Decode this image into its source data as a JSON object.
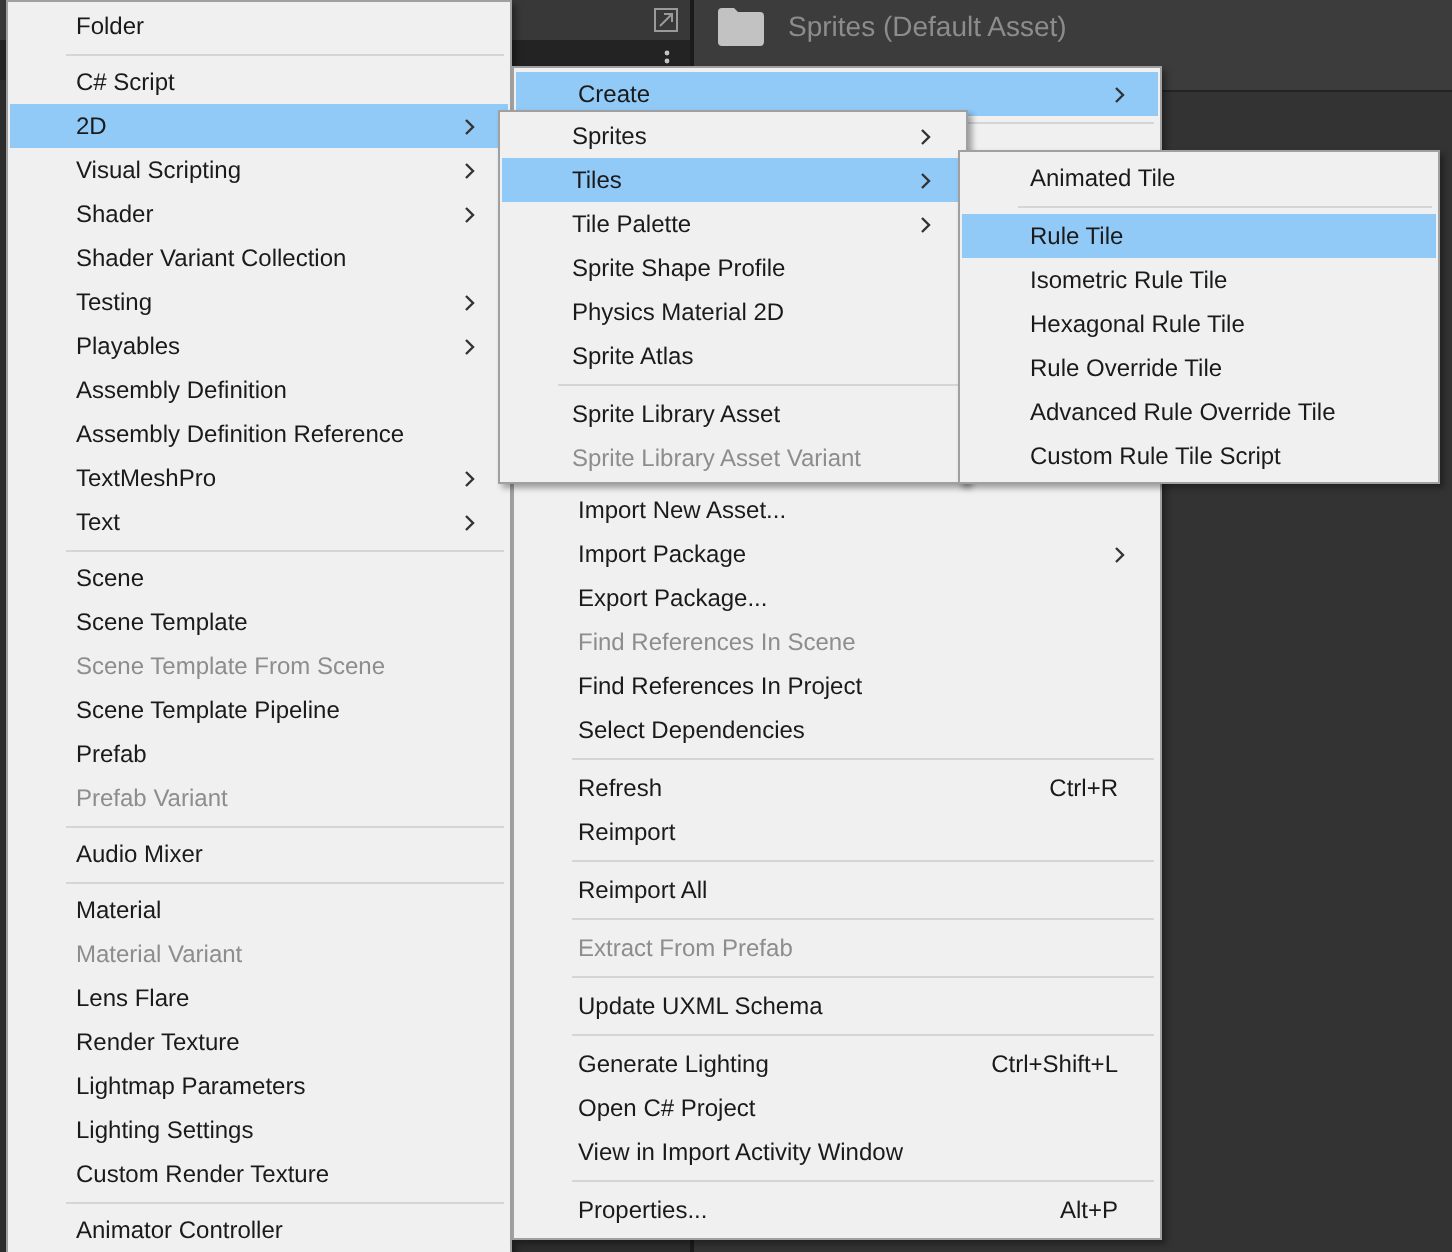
{
  "asset_header": {
    "title": "Sprites (Default Asset)"
  },
  "menus": [
    {
      "items": [
        {
          "kind": "item",
          "label": "Folder",
          "selected": false,
          "disabled": false,
          "submenu": false
        },
        {
          "kind": "separator"
        },
        {
          "kind": "item",
          "label": "C# Script",
          "selected": false,
          "disabled": false,
          "submenu": false
        },
        {
          "kind": "item",
          "label": "2D",
          "selected": true,
          "disabled": false,
          "submenu": true
        },
        {
          "kind": "item",
          "label": "Visual Scripting",
          "selected": false,
          "disabled": false,
          "submenu": true
        },
        {
          "kind": "item",
          "label": "Shader",
          "selected": false,
          "disabled": false,
          "submenu": true
        },
        {
          "kind": "item",
          "label": "Shader Variant Collection",
          "selected": false,
          "disabled": false,
          "submenu": false
        },
        {
          "kind": "item",
          "label": "Testing",
          "selected": false,
          "disabled": false,
          "submenu": true
        },
        {
          "kind": "item",
          "label": "Playables",
          "selected": false,
          "disabled": false,
          "submenu": true
        },
        {
          "kind": "item",
          "label": "Assembly Definition",
          "selected": false,
          "disabled": false,
          "submenu": false
        },
        {
          "kind": "item",
          "label": "Assembly Definition Reference",
          "selected": false,
          "disabled": false,
          "submenu": false
        },
        {
          "kind": "item",
          "label": "TextMeshPro",
          "selected": false,
          "disabled": false,
          "submenu": true
        },
        {
          "kind": "item",
          "label": "Text",
          "selected": false,
          "disabled": false,
          "submenu": true
        },
        {
          "kind": "separator"
        },
        {
          "kind": "item",
          "label": "Scene",
          "selected": false,
          "disabled": false,
          "submenu": false
        },
        {
          "kind": "item",
          "label": "Scene Template",
          "selected": false,
          "disabled": false,
          "submenu": false
        },
        {
          "kind": "item",
          "label": "Scene Template From Scene",
          "selected": false,
          "disabled": true,
          "submenu": false
        },
        {
          "kind": "item",
          "label": "Scene Template Pipeline",
          "selected": false,
          "disabled": false,
          "submenu": false
        },
        {
          "kind": "item",
          "label": "Prefab",
          "selected": false,
          "disabled": false,
          "submenu": false
        },
        {
          "kind": "item",
          "label": "Prefab Variant",
          "selected": false,
          "disabled": true,
          "submenu": false
        },
        {
          "kind": "separator"
        },
        {
          "kind": "item",
          "label": "Audio Mixer",
          "selected": false,
          "disabled": false,
          "submenu": false
        },
        {
          "kind": "separator"
        },
        {
          "kind": "item",
          "label": "Material",
          "selected": false,
          "disabled": false,
          "submenu": false
        },
        {
          "kind": "item",
          "label": "Material Variant",
          "selected": false,
          "disabled": true,
          "submenu": false
        },
        {
          "kind": "item",
          "label": "Lens Flare",
          "selected": false,
          "disabled": false,
          "submenu": false
        },
        {
          "kind": "item",
          "label": "Render Texture",
          "selected": false,
          "disabled": false,
          "submenu": false
        },
        {
          "kind": "item",
          "label": "Lightmap Parameters",
          "selected": false,
          "disabled": false,
          "submenu": false
        },
        {
          "kind": "item",
          "label": "Lighting Settings",
          "selected": false,
          "disabled": false,
          "submenu": false
        },
        {
          "kind": "item",
          "label": "Custom Render Texture",
          "selected": false,
          "disabled": false,
          "submenu": false
        },
        {
          "kind": "separator"
        },
        {
          "kind": "item",
          "label": "Animator Controller",
          "selected": false,
          "disabled": false,
          "submenu": false
        }
      ]
    },
    {
      "items": [
        {
          "kind": "item",
          "label": "Create",
          "selected": true,
          "disabled": false,
          "submenu": true
        },
        {
          "kind": "separator"
        },
        {
          "kind": "hidden"
        },
        {
          "kind": "item",
          "label": "Import New Asset...",
          "selected": false,
          "disabled": false,
          "submenu": false
        },
        {
          "kind": "item",
          "label": "Import Package",
          "selected": false,
          "disabled": false,
          "submenu": true
        },
        {
          "kind": "item",
          "label": "Export Package...",
          "selected": false,
          "disabled": false,
          "submenu": false
        },
        {
          "kind": "item",
          "label": "Find References In Scene",
          "selected": false,
          "disabled": true,
          "submenu": false
        },
        {
          "kind": "item",
          "label": "Find References In Project",
          "selected": false,
          "disabled": false,
          "submenu": false
        },
        {
          "kind": "item",
          "label": "Select Dependencies",
          "selected": false,
          "disabled": false,
          "submenu": false
        },
        {
          "kind": "separator"
        },
        {
          "kind": "item",
          "label": "Refresh",
          "shortcut": "Ctrl+R",
          "selected": false,
          "disabled": false,
          "submenu": false
        },
        {
          "kind": "item",
          "label": "Reimport",
          "selected": false,
          "disabled": false,
          "submenu": false
        },
        {
          "kind": "separator"
        },
        {
          "kind": "item",
          "label": "Reimport All",
          "selected": false,
          "disabled": false,
          "submenu": false
        },
        {
          "kind": "separator"
        },
        {
          "kind": "item",
          "label": "Extract From Prefab",
          "selected": false,
          "disabled": true,
          "submenu": false
        },
        {
          "kind": "separator"
        },
        {
          "kind": "item",
          "label": "Update UXML Schema",
          "selected": false,
          "disabled": false,
          "submenu": false
        },
        {
          "kind": "separator"
        },
        {
          "kind": "item",
          "label": "Generate Lighting",
          "shortcut": "Ctrl+Shift+L",
          "selected": false,
          "disabled": false,
          "submenu": false
        },
        {
          "kind": "item",
          "label": "Open C# Project",
          "selected": false,
          "disabled": false,
          "submenu": false
        },
        {
          "kind": "item",
          "label": "View in Import Activity Window",
          "selected": false,
          "disabled": false,
          "submenu": false
        },
        {
          "kind": "separator"
        },
        {
          "kind": "item",
          "label": "Properties...",
          "shortcut": "Alt+P",
          "selected": false,
          "disabled": false,
          "submenu": false
        }
      ]
    },
    {
      "items": [
        {
          "kind": "item",
          "label": "Sprites",
          "selected": false,
          "disabled": false,
          "submenu": true
        },
        {
          "kind": "item",
          "label": "Tiles",
          "selected": true,
          "disabled": false,
          "submenu": true
        },
        {
          "kind": "item",
          "label": "Tile Palette",
          "selected": false,
          "disabled": false,
          "submenu": true
        },
        {
          "kind": "item",
          "label": "Sprite Shape Profile",
          "selected": false,
          "disabled": false,
          "submenu": false
        },
        {
          "kind": "item",
          "label": "Physics Material 2D",
          "selected": false,
          "disabled": false,
          "submenu": false
        },
        {
          "kind": "item",
          "label": "Sprite Atlas",
          "selected": false,
          "disabled": false,
          "submenu": false
        },
        {
          "kind": "separator"
        },
        {
          "kind": "item",
          "label": "Sprite Library Asset",
          "selected": false,
          "disabled": false,
          "submenu": false
        },
        {
          "kind": "item",
          "label": "Sprite Library Asset Variant",
          "selected": false,
          "disabled": true,
          "submenu": false
        }
      ]
    },
    {
      "items": [
        {
          "kind": "item",
          "label": "Animated Tile",
          "selected": false,
          "disabled": false,
          "submenu": false
        },
        {
          "kind": "separator"
        },
        {
          "kind": "item",
          "label": "Rule Tile",
          "selected": true,
          "disabled": false,
          "submenu": false
        },
        {
          "kind": "item",
          "label": "Isometric Rule Tile",
          "selected": false,
          "disabled": false,
          "submenu": false
        },
        {
          "kind": "item",
          "label": "Hexagonal Rule Tile",
          "selected": false,
          "disabled": false,
          "submenu": false
        },
        {
          "kind": "item",
          "label": "Rule Override Tile",
          "selected": false,
          "disabled": false,
          "submenu": false
        },
        {
          "kind": "item",
          "label": "Advanced Rule Override Tile",
          "selected": false,
          "disabled": false,
          "submenu": false
        },
        {
          "kind": "item",
          "label": "Custom Rule Tile Script",
          "selected": false,
          "disabled": false,
          "submenu": false
        }
      ]
    }
  ]
}
